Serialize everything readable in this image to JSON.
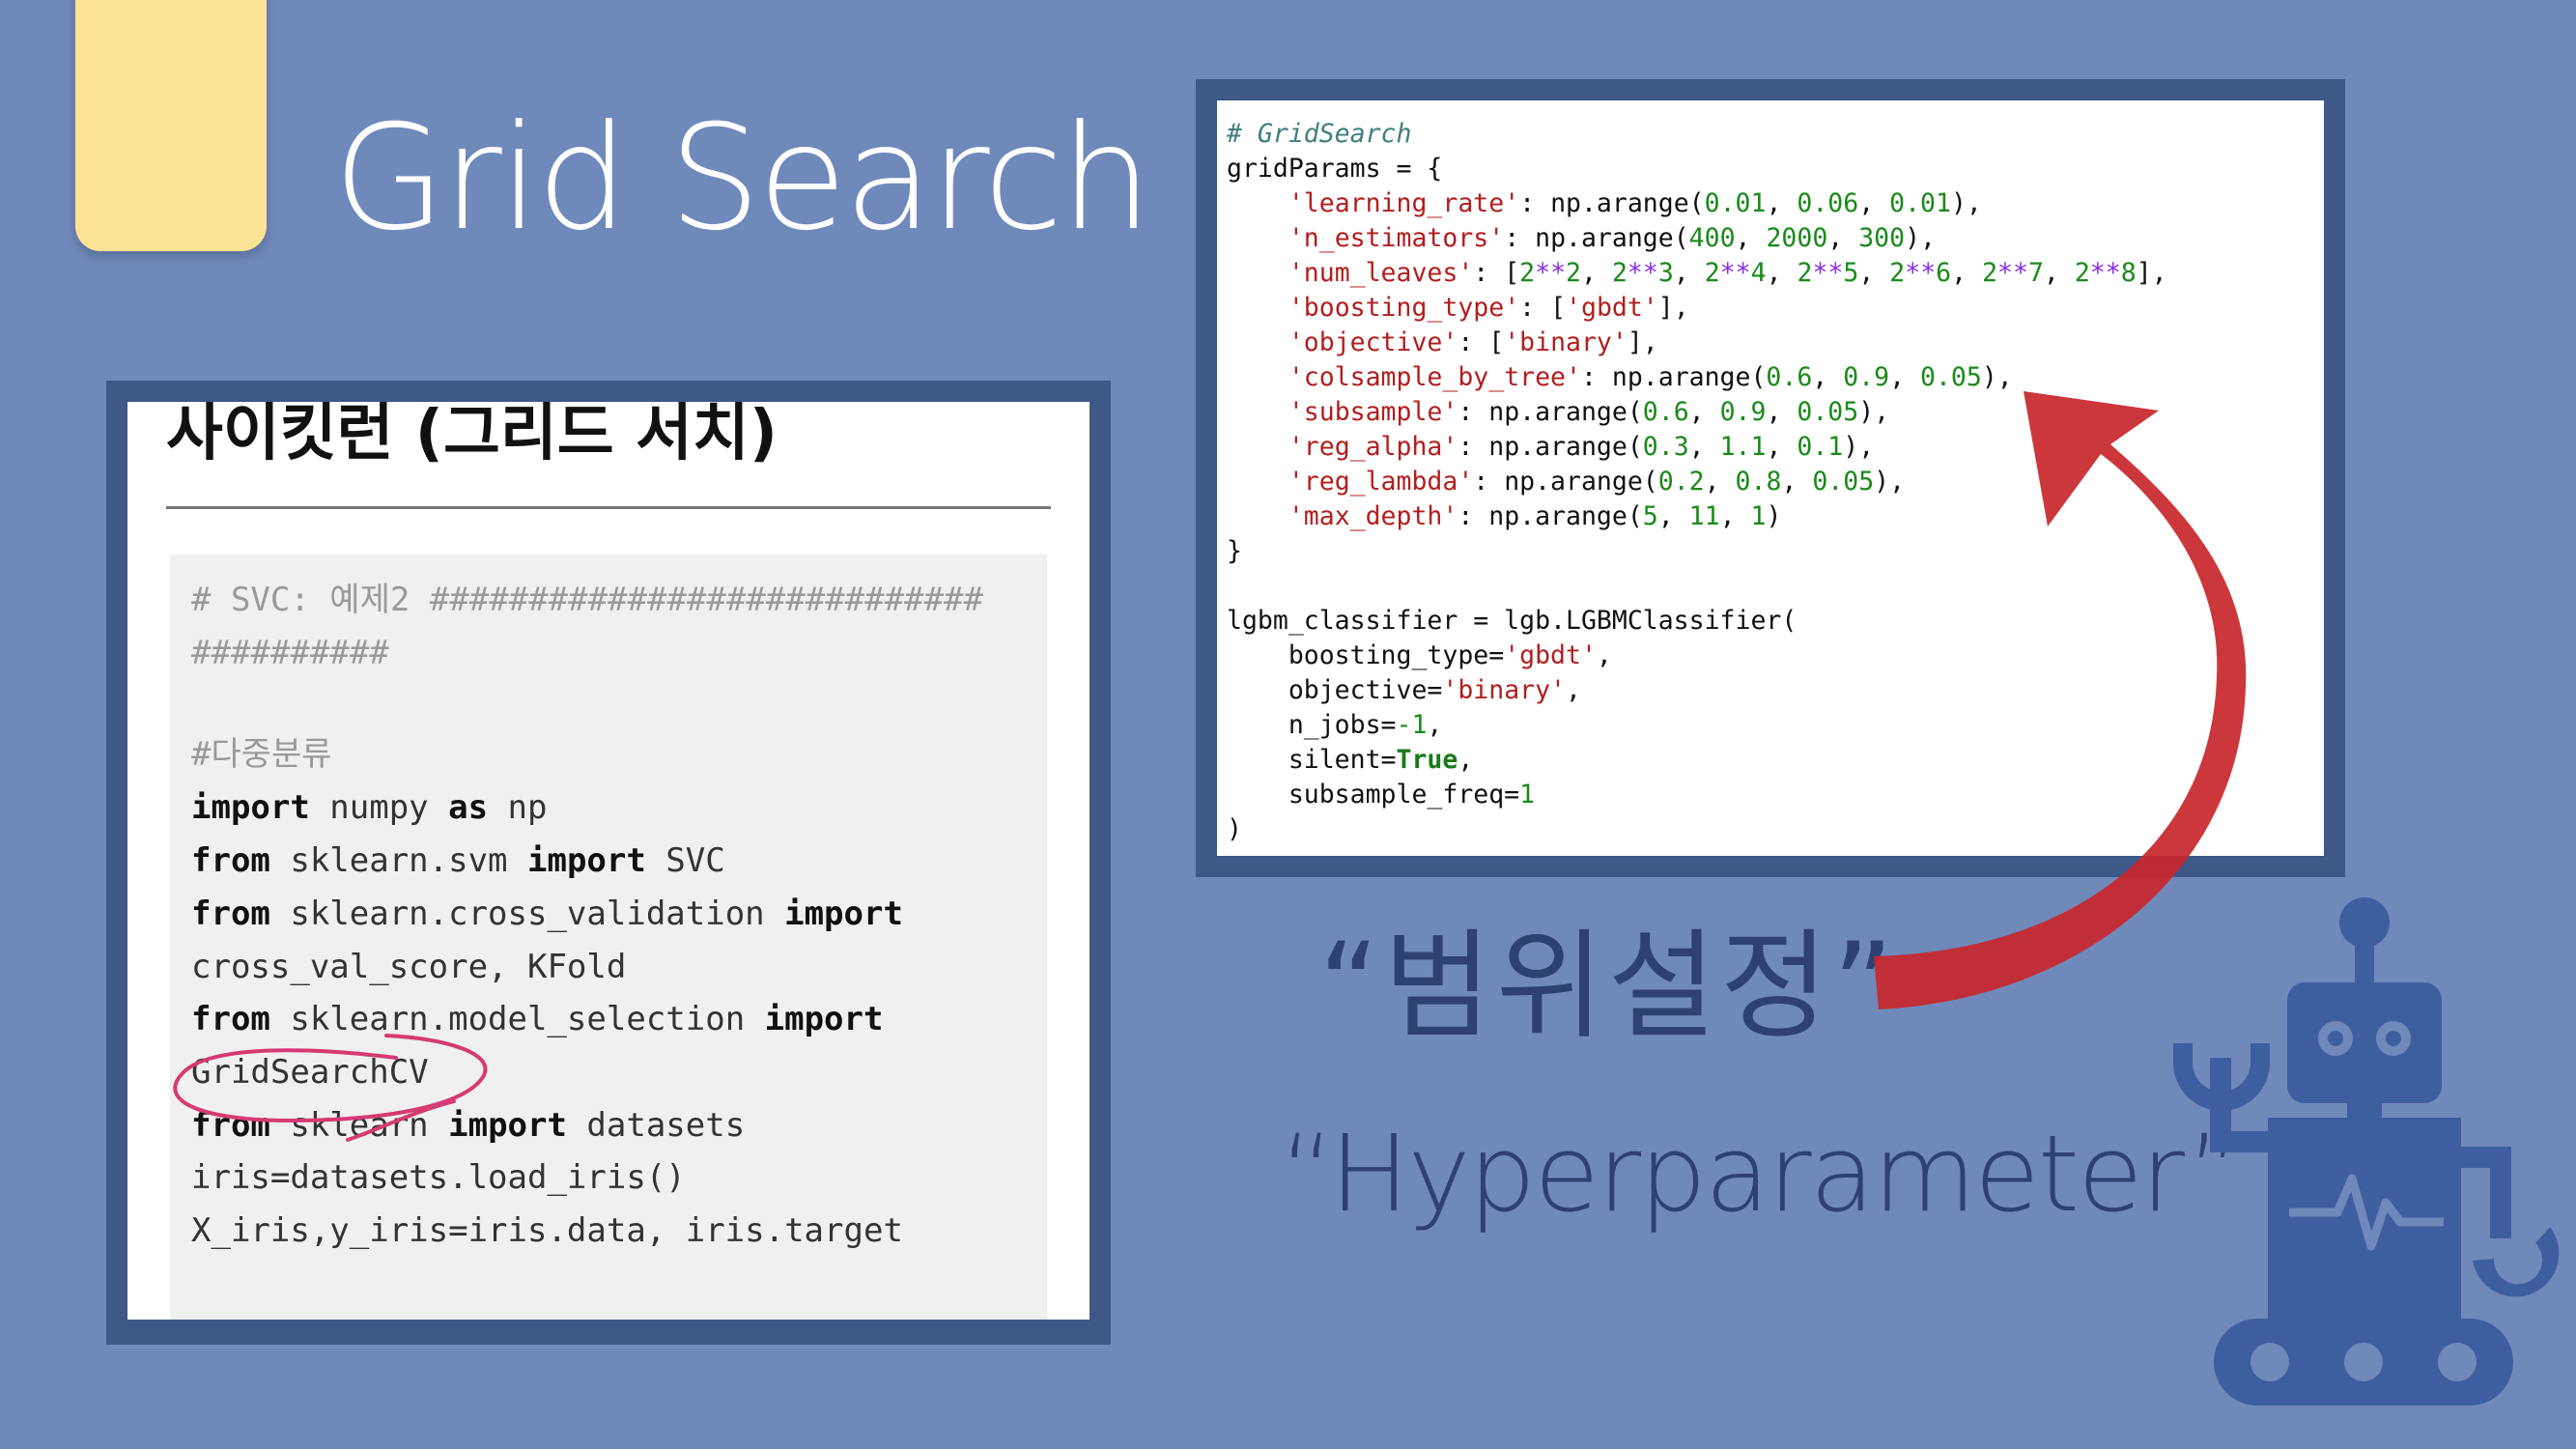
{
  "slide": {
    "title": "Grid Search"
  },
  "left_panel": {
    "heading": "사이킷런 (그리드 서치)",
    "code_lines": [
      "# SVC: 예제2 ############################",
      "##########",
      "#다중분류"
    ]
  },
  "right_panel": {},
  "captions": {
    "korean": "“범위설정”",
    "english": "“Hyperparameter”"
  },
  "colors": {
    "background": "#6f89bb",
    "frame": "#3e5888",
    "tab": "#fde396",
    "arrow": "#c8262b",
    "robot": "#3e5f9f",
    "caption": "#2d4272"
  },
  "icons": {
    "robot": "robot-icon",
    "arrow": "curved-arrow-icon",
    "circle_annotation": "hand-drawn-circle"
  }
}
